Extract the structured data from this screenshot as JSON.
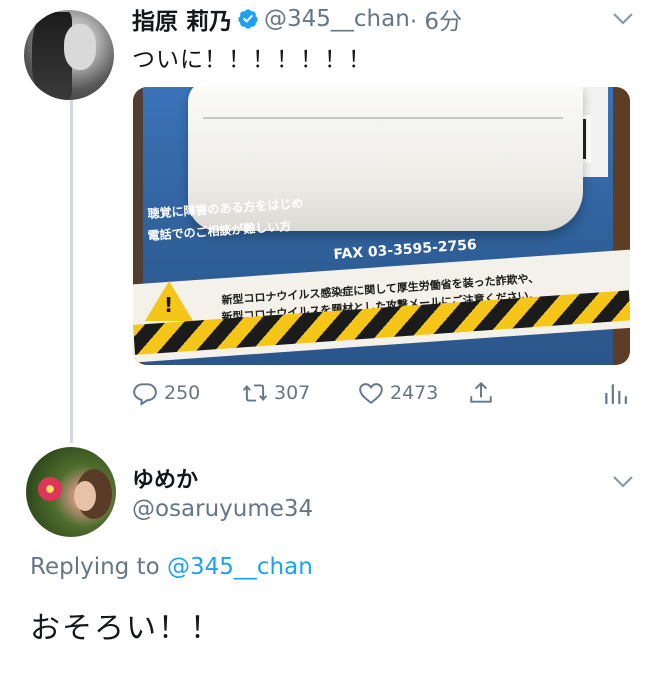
{
  "tweet1": {
    "name": "指原 莉乃",
    "handle": "@345__chan",
    "time": "· 6分",
    "text": "ついに！！！！！！！",
    "image_text": {
      "line1": "聴覚に障害のある方をはじめ",
      "line2": "電話でのご相談が難しい方",
      "fax": "FAX 03-3595-2756",
      "warning1": "新型コロナウイルス感染症に関して厚生労働省を装った詐欺や、",
      "warning2": "新型コロナウイルスを題材とした攻撃メールにご注意ください。"
    },
    "actions": {
      "replies": "250",
      "retweets": "307",
      "likes": "2473"
    }
  },
  "tweet2": {
    "name": "ゆめか",
    "handle": "@osaruyume34",
    "replying_prefix": "Replying to",
    "replying_to": "@345__chan",
    "text": "おそろい！！"
  },
  "colors": {
    "primary_text": "#14171a",
    "secondary_text": "#657786",
    "link": "#1da1f2",
    "thread_line": "#cfd9de",
    "verified": "#1da1f2"
  },
  "icons": [
    "verified-badge-icon",
    "chevron-down-icon",
    "reply-icon",
    "retweet-icon",
    "like-icon",
    "share-icon",
    "analytics-icon"
  ]
}
